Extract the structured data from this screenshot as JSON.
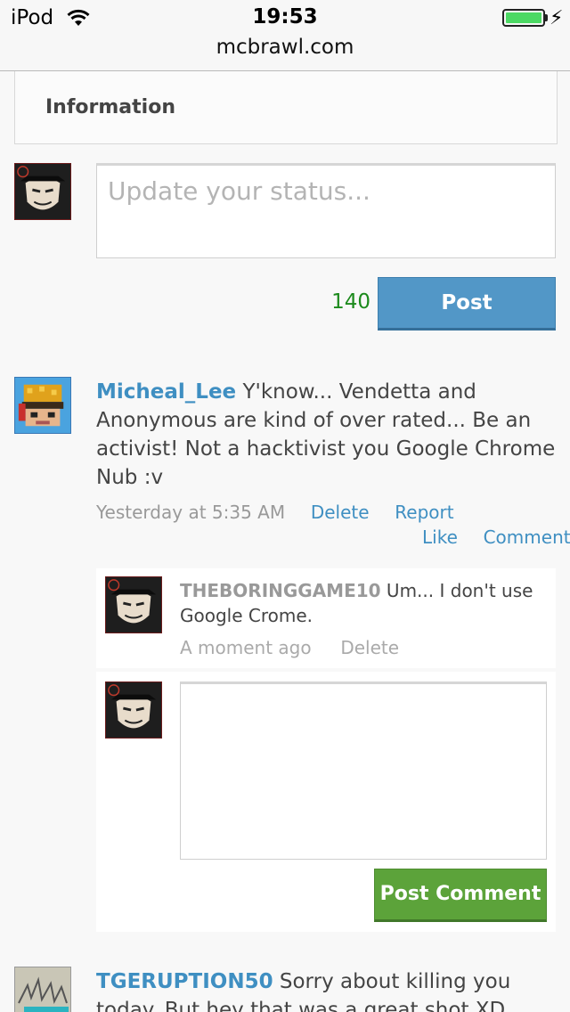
{
  "status_bar": {
    "carrier": "iPod",
    "time": "19:53",
    "url": "mcbrawl.com"
  },
  "info_box": {
    "title": "Information"
  },
  "status_composer": {
    "placeholder": "Update your status...",
    "char_count": "140",
    "post_label": "Post"
  },
  "post": {
    "author": "Micheal_Lee",
    "text": " Y'know... Vendetta and Anonymous are kind of over rated... Be an activist! Not a hacktivist you Google Chrome Nub :v",
    "timestamp": "Yesterday at 5:35 AM",
    "delete_label": "Delete",
    "report_label": "Report",
    "like_label": "Like",
    "comment_label": "Comment"
  },
  "comment": {
    "author": "THEBORINGGAME10",
    "text": " Um... I don't use Google Crome.",
    "timestamp": "A moment ago",
    "delete_label": "Delete"
  },
  "reply": {
    "button_label": "Post Comment"
  },
  "next_post": {
    "author": "TGERUPTION50",
    "text": " Sorry about killing you today. But hey that was a great shot XD"
  },
  "colors": {
    "link": "#3f8fc2",
    "post_button": "#5297c7",
    "post_comment_button": "#5ca33a",
    "char_count": "#1c8a1c",
    "battery": "#4cd964"
  }
}
